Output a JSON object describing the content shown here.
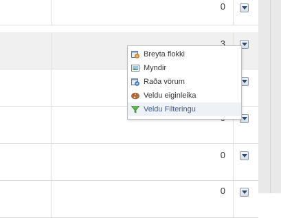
{
  "rows": [
    {
      "count": "0",
      "shaded": false
    },
    {
      "count": "3",
      "shaded": true
    },
    {
      "count": "",
      "shaded": false
    },
    {
      "count": "0",
      "shaded": false
    },
    {
      "count": "0",
      "shaded": false
    },
    {
      "count": "0",
      "shaded": false
    }
  ],
  "context_menu": {
    "items": [
      {
        "label": "Breyta flokki",
        "icon": "edit-category-icon"
      },
      {
        "label": "Myndir",
        "icon": "image-icon"
      },
      {
        "label": "Raða vörum",
        "icon": "sort-products-icon"
      },
      {
        "label": "Veldu eiginleika",
        "icon": "palette-icon"
      },
      {
        "label": "Veldu Filteringu",
        "icon": "filter-funnel-icon"
      }
    ],
    "active_index": 4
  },
  "colors": {
    "shaded_row": "#f0f0f0",
    "menu_active_bg": "#eef1f6",
    "menu_active_text": "#3b5b8c"
  }
}
